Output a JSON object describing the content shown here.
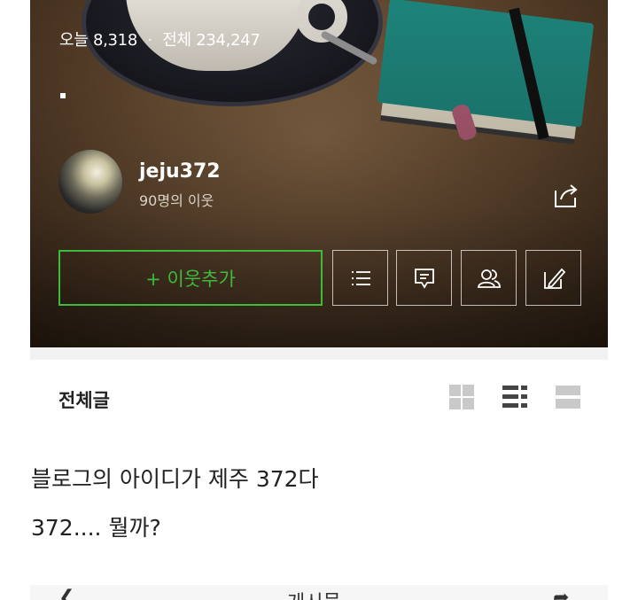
{
  "header": {
    "today_label": "오늘",
    "today_count": "8,318",
    "separator": "·",
    "total_label": "전체",
    "total_count": "234,247"
  },
  "profile": {
    "blog_id": "jeju372",
    "neighbor_count": "90명의 이웃"
  },
  "actions": {
    "add_neighbor_label": "+ 이웃추가",
    "icons": [
      "list-icon",
      "comment-icon",
      "people-icon",
      "write-icon"
    ],
    "share_icon": "share-icon"
  },
  "section": {
    "title": "전체글",
    "view_icons": [
      "grid-view-icon",
      "list-view-icon",
      "card-view-icon"
    ]
  },
  "post": {
    "line1": "블로그의 아이디가 제주 372다",
    "line2": "372.... 뭘까?"
  },
  "bottom_bar": {
    "label": "게시물",
    "left_icon": "back-arrow-icon",
    "right_icon": "forward-arrow-icon"
  },
  "colors": {
    "accent": "#3dbb3d",
    "text": "#222222",
    "divider": "#f2f2f2"
  }
}
